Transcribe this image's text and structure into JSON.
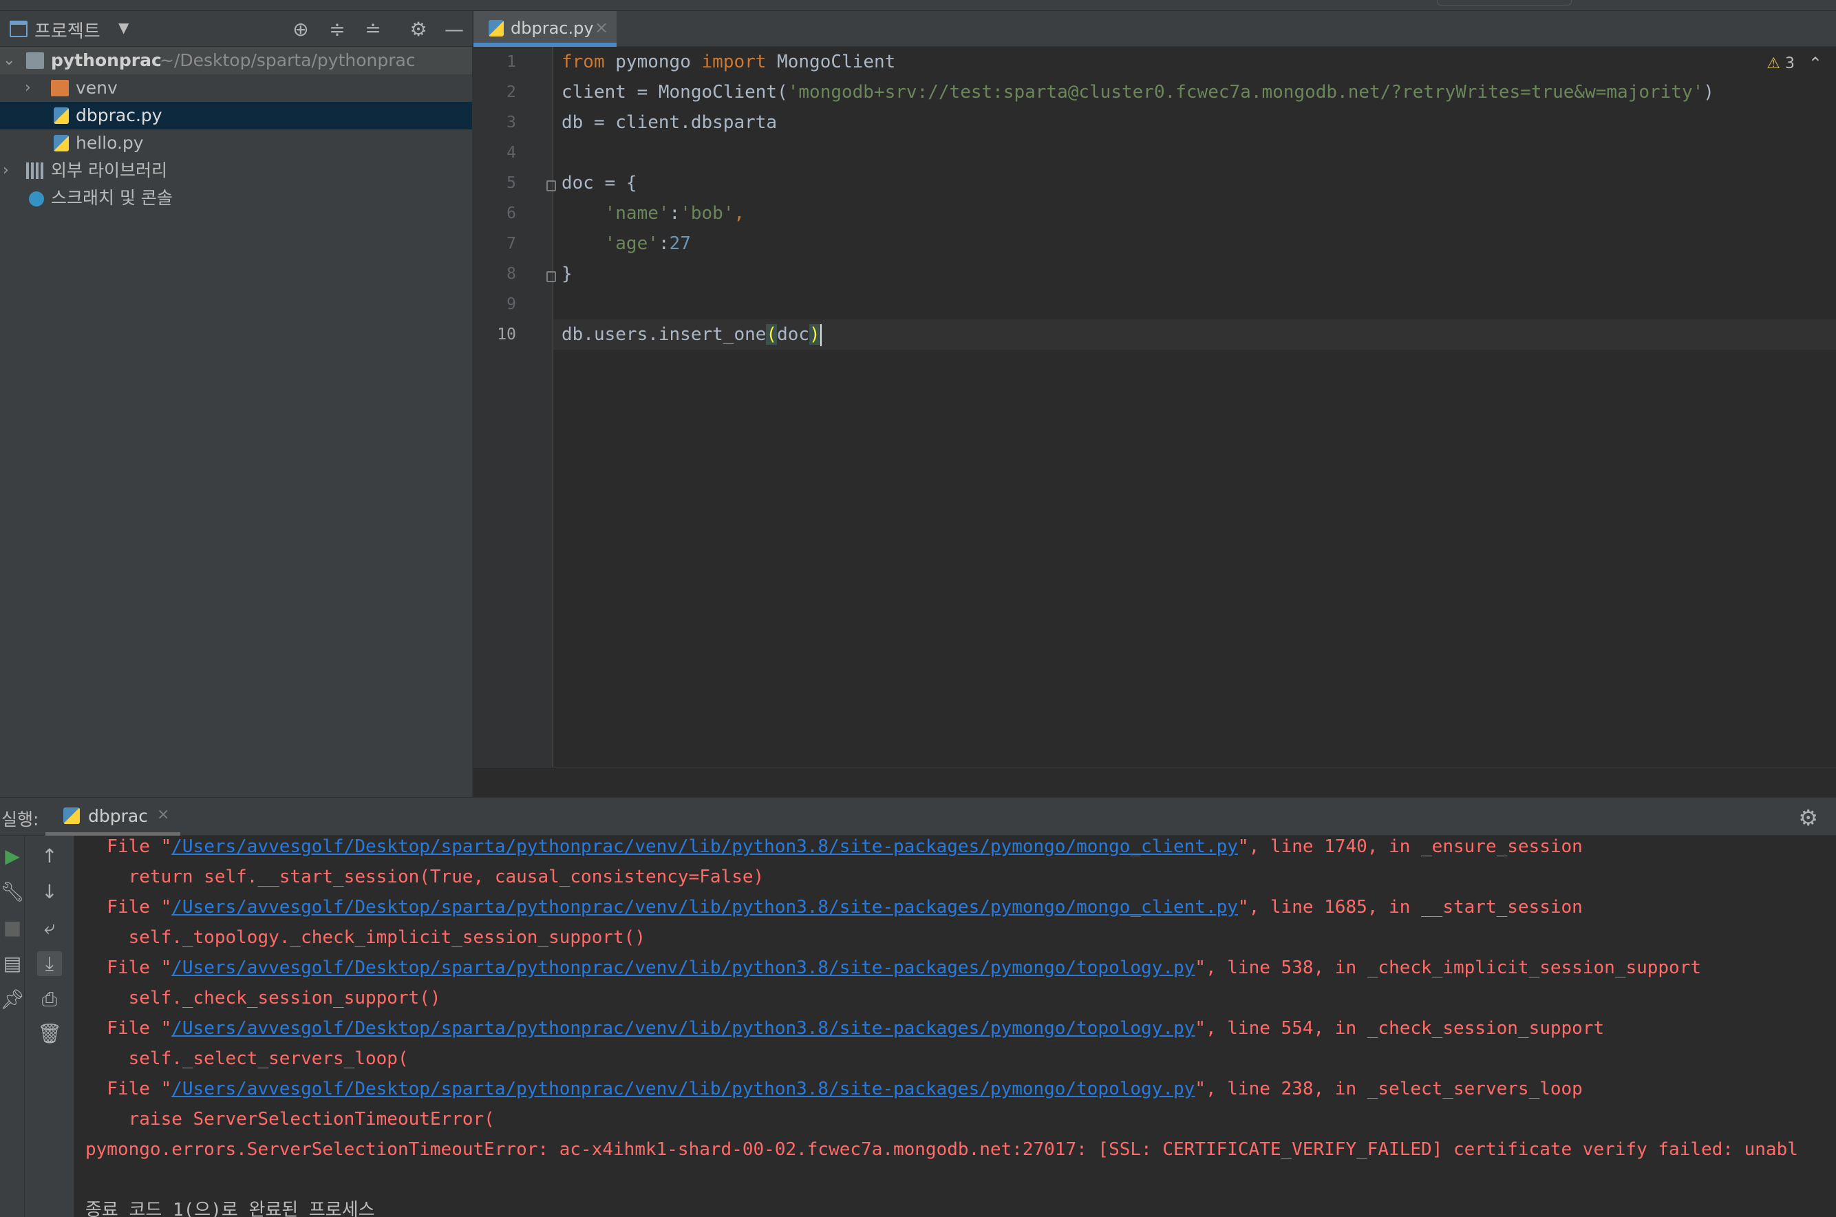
{
  "project_panel": {
    "title": "프로젝트",
    "root": {
      "name": "pythonprac",
      "path": "~/Desktop/sparta/pythonprac"
    },
    "items": [
      {
        "label": "venv"
      },
      {
        "label": "dbprac.py"
      },
      {
        "label": "hello.py"
      },
      {
        "label": "외부 라이브러리"
      },
      {
        "label": "스크래치 및 콘솔"
      }
    ]
  },
  "editor": {
    "tab_label": "dbprac.py",
    "warnings_count": "3",
    "line_numbers": [
      "1",
      "2",
      "3",
      "4",
      "5",
      "6",
      "7",
      "8",
      "9",
      "10"
    ],
    "code": {
      "l1_from": "from",
      "l1_mod": " pymongo ",
      "l1_import": "import",
      "l1_name": " MongoClient",
      "l2_pre": "client = MongoClient(",
      "l2_str": "'mongodb+srv://test:sparta@cluster0.fcwec7a.mongodb.net/?retryWrites=true&w=majority'",
      "l2_post": ")",
      "l3": "db = client.dbsparta",
      "l5": "doc = {",
      "l6_key": "'name'",
      "l6_colon": ":",
      "l6_val": "'bob'",
      "l6_comma": ",",
      "l7_key": "'age'",
      "l7_colon": ":",
      "l7_val": "27",
      "l8": "}",
      "l10_pre": "db.users.insert_one",
      "l10_open": "(",
      "l10_arg": "doc",
      "l10_close": ")"
    }
  },
  "run_panel": {
    "title": "실행:",
    "tab_label": "dbprac",
    "console": [
      {
        "pre": "  File \"",
        "link": "/Users/avvesgolf/Desktop/sparta/pythonprac/venv/lib/python3.8/site-packages/pymongo/mongo_client.py",
        "post": "\", line 1740, in _ensure_session"
      },
      {
        "text": "    return self.__start_session(True, causal_consistency=False)"
      },
      {
        "pre": "  File \"",
        "link": "/Users/avvesgolf/Desktop/sparta/pythonprac/venv/lib/python3.8/site-packages/pymongo/mongo_client.py",
        "post": "\", line 1685, in __start_session"
      },
      {
        "text": "    self._topology._check_implicit_session_support()"
      },
      {
        "pre": "  File \"",
        "link": "/Users/avvesgolf/Desktop/sparta/pythonprac/venv/lib/python3.8/site-packages/pymongo/topology.py",
        "post": "\", line 538, in _check_implicit_session_support"
      },
      {
        "text": "    self._check_session_support()"
      },
      {
        "pre": "  File \"",
        "link": "/Users/avvesgolf/Desktop/sparta/pythonprac/venv/lib/python3.8/site-packages/pymongo/topology.py",
        "post": "\", line 554, in _check_session_support"
      },
      {
        "text": "    self._select_servers_loop("
      },
      {
        "pre": "  File \"",
        "link": "/Users/avvesgolf/Desktop/sparta/pythonprac/venv/lib/python3.8/site-packages/pymongo/topology.py",
        "post": "\", line 238, in _select_servers_loop"
      },
      {
        "text": "    raise ServerSelectionTimeoutError("
      },
      {
        "text": "pymongo.errors.ServerSelectionTimeoutError: ac-x4ihmk1-shard-00-02.fcwec7a.mongodb.net:27017: [SSL: CERTIFICATE_VERIFY_FAILED] certificate verify failed: unabl"
      },
      {
        "text": "종료 코드 1(으)로 완료된 프로세스"
      }
    ]
  },
  "colors": {
    "background": "#2b2b2b",
    "panel": "#3c3f41",
    "selection": "#0d293e",
    "keyword": "#cc7832",
    "string": "#6a8759",
    "number": "#6897bb",
    "error": "#ff6b68",
    "link": "#287bde",
    "accent": "#4a88c7"
  },
  "icons": [
    "project-window-icon",
    "locate-icon",
    "expand-all-icon",
    "collapse-all-icon",
    "gear-icon",
    "minimize-icon",
    "folder-icon",
    "python-file-icon",
    "library-icon",
    "scratch-icon",
    "warning-icon",
    "run-icon",
    "wrench-icon",
    "stop-icon",
    "up-arrow-icon",
    "down-arrow-icon",
    "soft-wrap-icon",
    "scroll-to-end-icon",
    "print-icon",
    "trash-icon",
    "pin-icon",
    "layout-icon"
  ]
}
